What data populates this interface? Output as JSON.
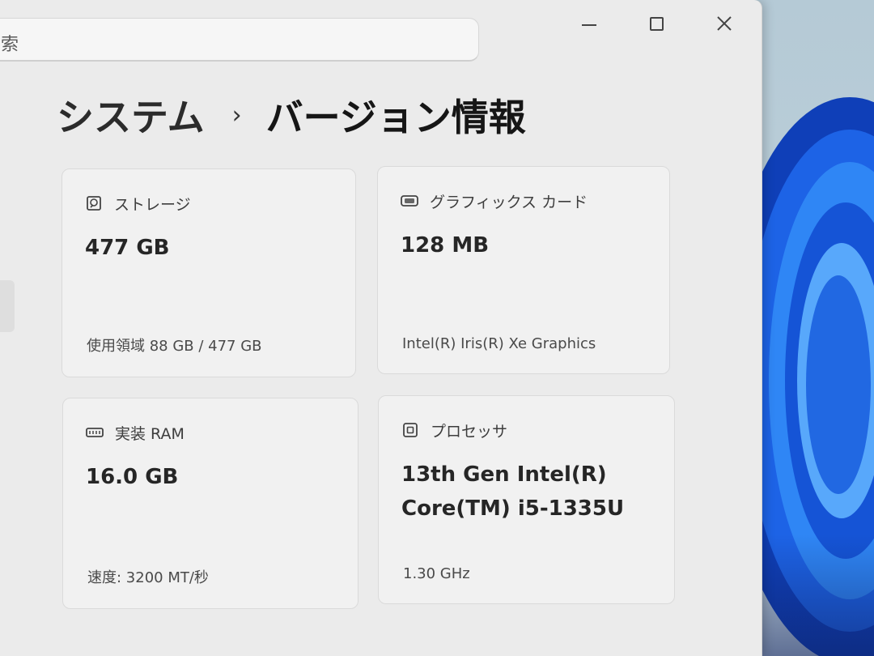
{
  "search": {
    "text": "索"
  },
  "window_controls": {
    "minimize_icon": "minimize-icon",
    "maximize_icon": "maximize-icon",
    "close_icon": "close-icon",
    "close_glyph": "✕"
  },
  "breadcrumb": {
    "parent": "システム",
    "separator": "›",
    "current": "バージョン情報"
  },
  "cards": {
    "storage": {
      "icon": "storage-icon",
      "label": "ストレージ",
      "value": "477 GB",
      "detail": "使用領域 88 GB / 477 GB"
    },
    "gpu": {
      "icon": "graphics-card-icon",
      "label": "グラフィックス カード",
      "value": "128 MB",
      "detail": "Intel(R) Iris(R) Xe Graphics"
    },
    "ram": {
      "icon": "memory-icon",
      "label": "実装 RAM",
      "value": "16.0 GB",
      "detail": "速度: 3200 MT/秒"
    },
    "cpu": {
      "icon": "processor-icon",
      "label": "プロセッサ",
      "value_line1": "13th Gen Intel(R)",
      "value_line2": "Core(TM) i5-1335U",
      "detail": "1.30 GHz"
    }
  },
  "colors": {
    "window_bg": "#ebebeb",
    "card_bg": "#f1f1f1",
    "wallpaper_accent": "#1d63e6"
  }
}
